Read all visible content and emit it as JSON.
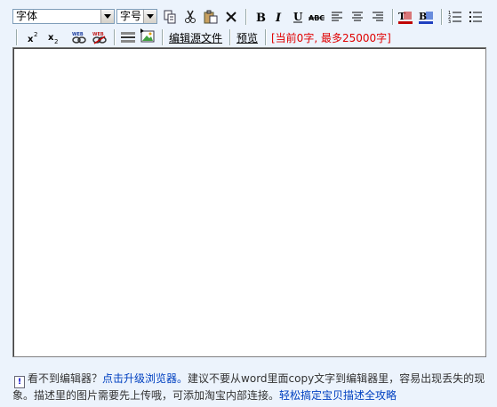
{
  "toolbar": {
    "font_select": "字体",
    "size_select": "字号",
    "icons": [
      "copy-icon",
      "cut-icon",
      "paste-icon",
      "delete-icon",
      "bold-icon",
      "italic-icon",
      "underline-icon",
      "strikethrough-icon",
      "align-left-icon",
      "align-center-icon",
      "align-right-icon",
      "text-color-icon",
      "background-color-icon",
      "ordered-list-icon",
      "unordered-list-icon",
      "superscript-icon",
      "subscript-icon",
      "insert-link-icon",
      "remove-link-icon",
      "horizontal-rule-icon",
      "insert-image-icon"
    ],
    "edit_source": "编辑源文件",
    "preview": "预览",
    "counter": "[当前0字, 最多25000字]"
  },
  "notice": {
    "warn_glyph": "!",
    "part1": "看不到编辑器？",
    "upgrade_link": "点击升级浏览器。",
    "part2": "建议不要从word里面copy文字到编辑器里，容易出现丢失的现象。描述里的图片需要先上传哦，可添加淘宝内部连接。",
    "guide_link": "轻松搞定宝贝描述全攻略"
  },
  "colors": {
    "background": "#ecf3fc",
    "counter": "#e00000",
    "link": "#0040c0"
  }
}
